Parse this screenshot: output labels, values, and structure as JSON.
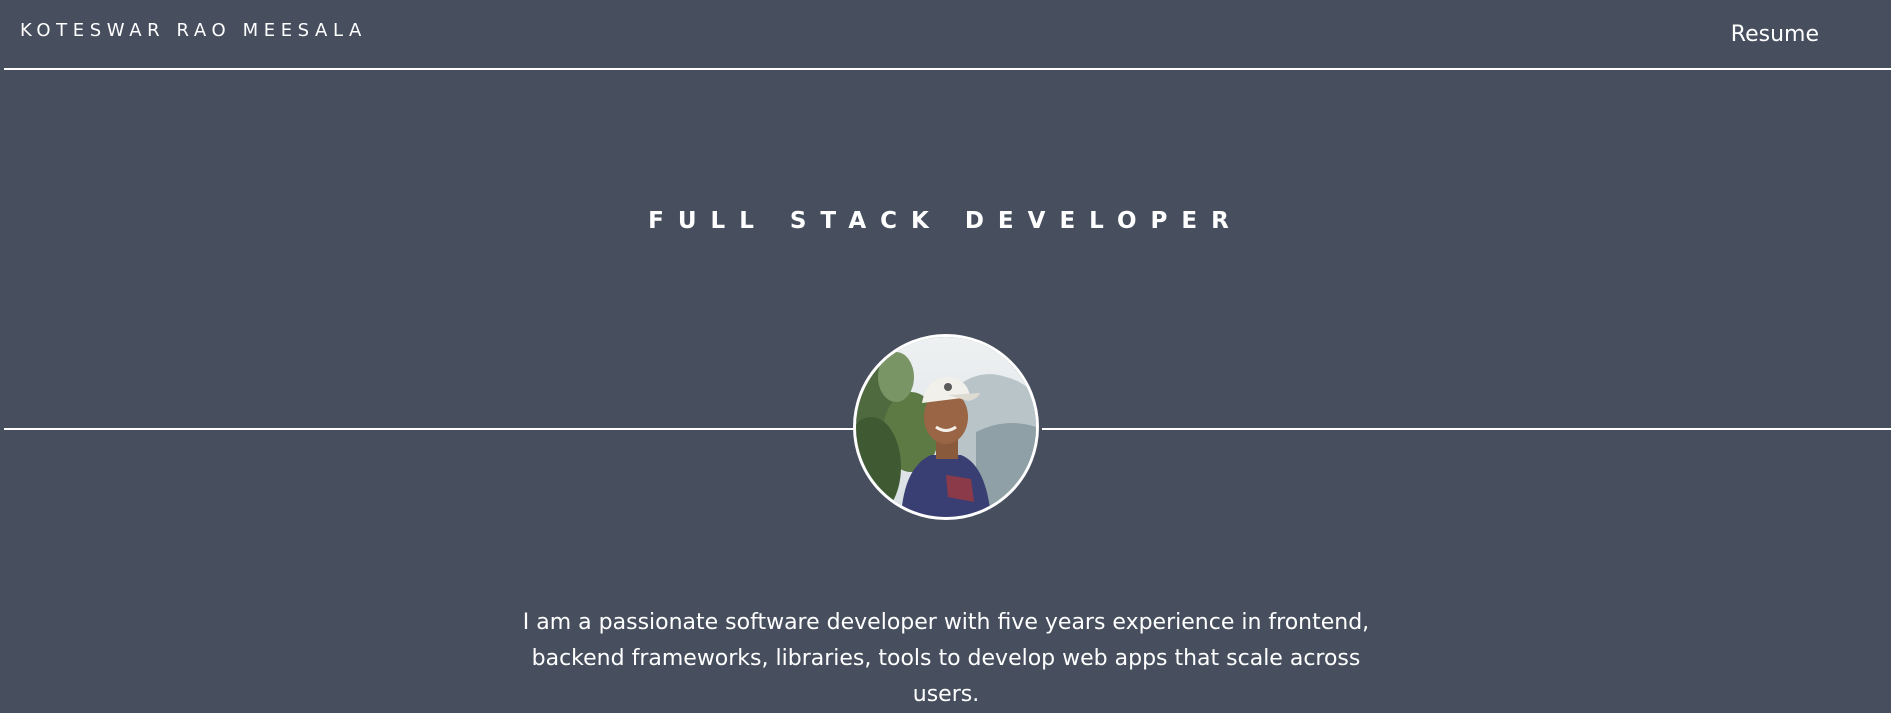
{
  "header": {
    "brand": "KOTESWAR RAO MEESALA",
    "resume_label": "Resume"
  },
  "hero": {
    "title": "FULL STACK DEVELOPER",
    "bio": "I am a passionate software developer with five years experience in frontend, backend frameworks, libraries, tools to develop web apps that scale across users."
  },
  "colors": {
    "background": "#474f5f",
    "text": "#ffffff",
    "rule": "#ffffff"
  }
}
